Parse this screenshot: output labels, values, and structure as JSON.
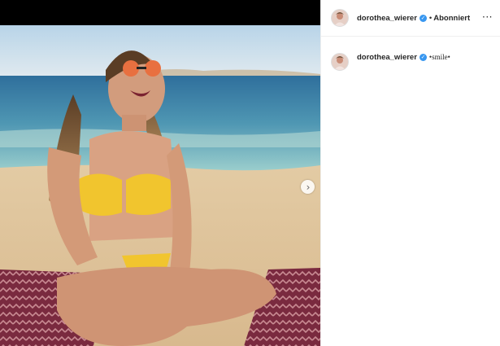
{
  "post": {
    "author": "dorothea_wierer",
    "verified_icon": "verified-badge-icon",
    "follow_status": "Abonniert",
    "separator": "•",
    "more_icon": "more-options-icon",
    "more_label": "···"
  },
  "comments": [
    {
      "author": "dorothea_wierer",
      "text": "•smile•"
    }
  ],
  "media": {
    "next_icon": "chevron-right-icon",
    "next_label": "›"
  },
  "colors": {
    "verified": "#3897f0",
    "text": "#262626",
    "border": "#efefef"
  }
}
